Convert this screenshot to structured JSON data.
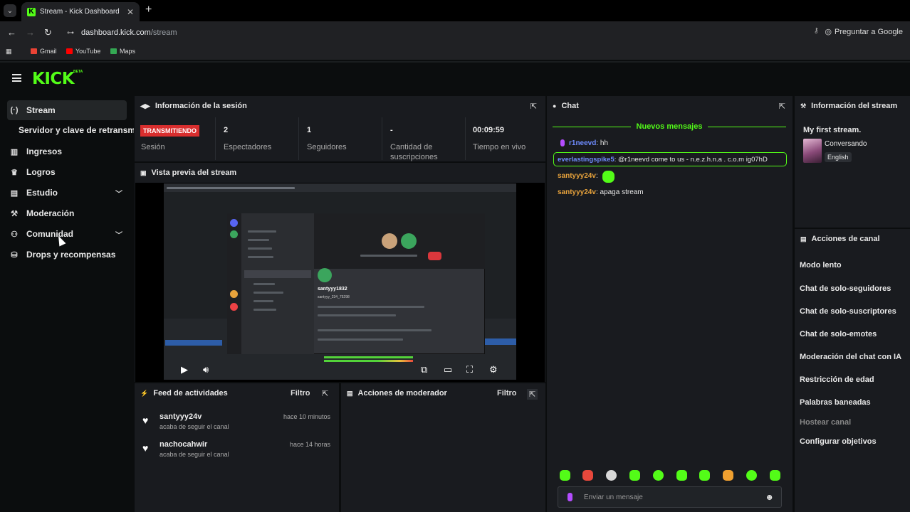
{
  "browser": {
    "tab_title": "Stream - Kick Dashboard",
    "tab_favicon": "K",
    "url_host": "dashboard.kick.com",
    "url_path": "/stream",
    "ask_google": "Preguntar a Google",
    "bookmarks": [
      {
        "label": "Gmail",
        "color": "#ea4335"
      },
      {
        "label": "YouTube",
        "color": "#ff0000"
      },
      {
        "label": "Maps",
        "color": "#34a853"
      }
    ]
  },
  "brand": {
    "logo": "KICK",
    "beta": "BETA",
    "accent": "#53fc18"
  },
  "sidebar": {
    "items": [
      {
        "label": "Stream",
        "icon": "broadcast-icon",
        "active": true
      },
      {
        "label": "Ingresos",
        "icon": "chart-icon"
      },
      {
        "label": "Logros",
        "icon": "trophy-icon"
      },
      {
        "label": "Estudio",
        "icon": "studio-icon",
        "expandable": true
      },
      {
        "label": "Moderación",
        "icon": "wrench-icon"
      },
      {
        "label": "Comunidad",
        "icon": "community-icon",
        "expandable": true
      },
      {
        "label": "Drops y recompensas",
        "icon": "drops-icon"
      }
    ],
    "sub_item": "Servidor y clave de retransmisión"
  },
  "session": {
    "title": "Información de la sesión",
    "live_badge": "TRANSMITIENDO",
    "live_color": "#d92e2e",
    "stats": [
      {
        "value": "",
        "label": "Sesión"
      },
      {
        "value": "2",
        "label": "Espectadores"
      },
      {
        "value": "1",
        "label": "Seguidores"
      },
      {
        "value": "-",
        "label": "Cantidad de suscripciones"
      },
      {
        "value": "00:09:59",
        "label": "Tiempo en vivo"
      }
    ]
  },
  "preview": {
    "title": "Vista previa del stream",
    "discord_user": "santyyy1832",
    "discord_handle": "santyyy_234_75298"
  },
  "feed": {
    "title": "Feed de actividades",
    "filter": "Filtro",
    "items": [
      {
        "user": "santyyy24v",
        "action": "acaba de seguir el canal",
        "time": "hace 10 minutos"
      },
      {
        "user": "nachocahwir",
        "action": "acaba de seguir el canal",
        "time": "hace 14 horas"
      }
    ]
  },
  "mod_actions": {
    "title": "Acciones de moderador",
    "filter": "Filtro"
  },
  "chat": {
    "title": "Chat",
    "new_messages": "Nuevos mensajes",
    "messages": [
      {
        "user": "r1neevd",
        "text": ": hh",
        "color": "#6f8cff",
        "badge": "mic-badge-icon"
      },
      {
        "user": "everlastingspike5",
        "text": ": @r1neevd come to us - n.e.z.h.n.a . c.o.m ig07hD",
        "color": "#6f8cff",
        "highlight": true
      },
      {
        "user": "santyyy24v",
        "text": ": ",
        "color": "#e8a33c",
        "emote": "green-blob-emote-icon"
      },
      {
        "user": "santyyy24v",
        "text": ": apaga stream",
        "color": "#e8a33c"
      }
    ],
    "input_placeholder": "Enviar un mensaje",
    "emotes": [
      "#53fc18",
      "#e8483c",
      "#53fc18",
      "#53fc18",
      "#53fc18",
      "#53fc18",
      "#53fc18",
      "#f0a030",
      "#53fc18",
      "#53fc18"
    ]
  },
  "stream_info": {
    "title": "Información del stream",
    "stream_title": "My first stream.",
    "category": "Conversando",
    "language": "English"
  },
  "channel_actions": {
    "title": "Acciones de canal",
    "items": [
      {
        "label": "Modo lento"
      },
      {
        "label": "Chat de solo-seguidores"
      },
      {
        "label": "Chat de solo-suscriptores"
      },
      {
        "label": "Chat de solo-emotes"
      },
      {
        "label": "Moderación del chat con IA"
      },
      {
        "label": "Restricción de edad"
      },
      {
        "label": "Palabras baneadas"
      },
      {
        "label": "Hostear canal",
        "disabled": true
      },
      {
        "label": "Configurar objetivos"
      }
    ]
  }
}
